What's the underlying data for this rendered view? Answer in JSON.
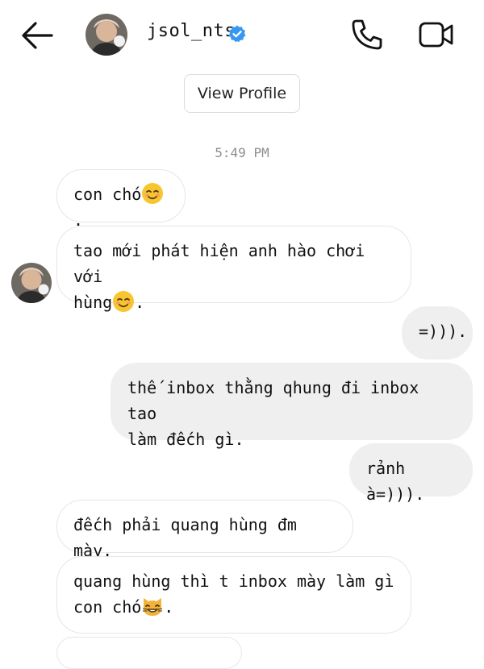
{
  "header": {
    "username": "jsol_nts",
    "back_icon": "arrow-left-icon",
    "verified_icon": "verified-badge-icon",
    "call_icon": "phone-icon",
    "video_icon": "video-camera-icon"
  },
  "profile_button": {
    "label": "View Profile"
  },
  "conversation": {
    "timestamp": "5:49 PM",
    "messages": [
      {
        "direction": "in",
        "text": "con chó",
        "suffix": ".",
        "emoji": "smiling-face-emoji"
      },
      {
        "direction": "in",
        "line1": "tao mới phát hiện anh hào chơi với",
        "line2_text": "hùng",
        "suffix": ".",
        "emoji": "smiling-face-emoji"
      },
      {
        "direction": "out",
        "text": "=)))."
      },
      {
        "direction": "out",
        "line1": "thế inbox thằng qhung đi inbox tao",
        "line2": "làm đếch gì."
      },
      {
        "direction": "out",
        "text": "rảnh à=)))."
      },
      {
        "direction": "in",
        "text": "đếch phải quang hùng đm mày."
      },
      {
        "direction": "in",
        "line1": "quang hùng thì t inbox mày làm gì",
        "line2_text": "con chó",
        "suffix": ".",
        "emoji": "grinning-cat-emoji"
      }
    ]
  },
  "colors": {
    "incoming_bubble": "#ffffff",
    "outgoing_bubble": "#efefef",
    "verified": "#3897f0",
    "timestamp": "#8e8e8e"
  }
}
